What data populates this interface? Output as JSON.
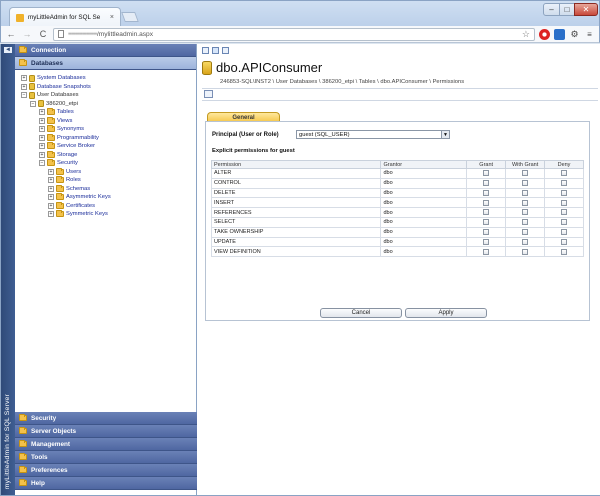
{
  "browser": {
    "tab_title": "myLittleAdmin for SQL Se",
    "tab_close": "×",
    "url_host_blurred": "••••••••••••••••",
    "url_path": "/mylittleadmin.aspx",
    "window_controls": {
      "minimize": "–",
      "maximize": "□",
      "close": "✕"
    },
    "nav": {
      "back": "←",
      "forward": "→",
      "reload": "C"
    },
    "star": "☆",
    "gear": "⚙",
    "menu": "≡"
  },
  "sidebar": {
    "vertical_title": "myLittleAdmin for SQL Server",
    "collapse_arrow": "◄",
    "top_sections": [
      {
        "label": "Connection",
        "active": false
      },
      {
        "label": "Databases",
        "active": true
      }
    ],
    "tree": [
      {
        "label": "System Databases",
        "depth": 0,
        "exp": "+",
        "icon": "database"
      },
      {
        "label": "Database Snapshots",
        "depth": 0,
        "exp": "+",
        "icon": "database"
      },
      {
        "label": "User Databases",
        "depth": 0,
        "exp": "−",
        "icon": "database",
        "plain": true
      },
      {
        "label": "386200_etpi",
        "depth": 1,
        "exp": "−",
        "icon": "database",
        "plain": true
      },
      {
        "label": "Tables",
        "depth": 2,
        "exp": "+",
        "icon": "folder"
      },
      {
        "label": "Views",
        "depth": 2,
        "exp": "+",
        "icon": "folder"
      },
      {
        "label": "Synonyms",
        "depth": 2,
        "exp": "+",
        "icon": "folder"
      },
      {
        "label": "Programmability",
        "depth": 2,
        "exp": "+",
        "icon": "folder"
      },
      {
        "label": "Service Broker",
        "depth": 2,
        "exp": "+",
        "icon": "folder"
      },
      {
        "label": "Storage",
        "depth": 2,
        "exp": "+",
        "icon": "folder"
      },
      {
        "label": "Security",
        "depth": 2,
        "exp": "−",
        "icon": "folder"
      },
      {
        "label": "Users",
        "depth": 3,
        "exp": "+",
        "icon": "folder"
      },
      {
        "label": "Roles",
        "depth": 3,
        "exp": "+",
        "icon": "folder"
      },
      {
        "label": "Schemas",
        "depth": 3,
        "exp": "+",
        "icon": "folder"
      },
      {
        "label": "Asymmetric Keys",
        "depth": 3,
        "exp": "+",
        "icon": "folder"
      },
      {
        "label": "Certificates",
        "depth": 3,
        "exp": "+",
        "icon": "folder"
      },
      {
        "label": "Symmetric Keys",
        "depth": 3,
        "exp": "+",
        "icon": "folder"
      }
    ],
    "bottom_sections": [
      "Security",
      "Server Objects",
      "Management",
      "Tools",
      "Preferences",
      "Help"
    ]
  },
  "main": {
    "title": "dbo.APIConsumer",
    "breadcrumb": "246853-SQL\\INST2 \\ User Databases \\ 386200_etpi \\ Tables \\ dbo.APIConsumer \\ Permissions",
    "tab_general": "General",
    "principal_label": "Principal (User or Role)",
    "principal_value": "guest (SQL_USER)",
    "dropdown_arrow": "▼",
    "explicit_label": "Explicit permissions for guest",
    "columns": [
      "Permission",
      "Grantor",
      "Grant",
      "With Grant",
      "Deny"
    ],
    "rows": [
      {
        "permission": "ALTER",
        "grantor": "dbo"
      },
      {
        "permission": "CONTROL",
        "grantor": "dbo"
      },
      {
        "permission": "DELETE",
        "grantor": "dbo"
      },
      {
        "permission": "INSERT",
        "grantor": "dbo"
      },
      {
        "permission": "REFERENCES",
        "grantor": "dbo"
      },
      {
        "permission": "SELECT",
        "grantor": "dbo"
      },
      {
        "permission": "TAKE OWNERSHIP",
        "grantor": "dbo"
      },
      {
        "permission": "UPDATE",
        "grantor": "dbo"
      },
      {
        "permission": "VIEW DEFINITION",
        "grantor": "dbo"
      }
    ],
    "cancel_label": "Cancel",
    "apply_label": "Apply"
  },
  "colors": {
    "accordion": "#4f67a1",
    "accordion_active": "#9db3db",
    "sidebar_strip": "#2f4a78",
    "tab_active": "#f5c64a",
    "tree_link": "#1a2c9a"
  }
}
